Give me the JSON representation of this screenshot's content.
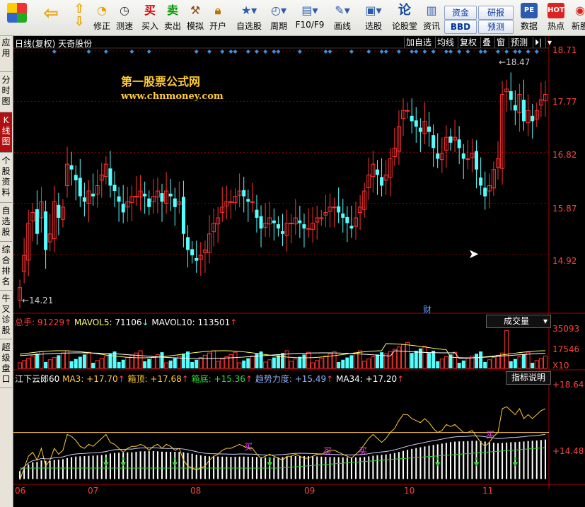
{
  "toolbar": {
    "buttons": [
      {
        "name": "fullscreen",
        "label": "",
        "icon": "grid-logo-icon"
      },
      {
        "name": "back",
        "label": "",
        "icon": "back-arrow-icon"
      },
      {
        "name": "up-down",
        "label": "",
        "icon": "up-down-icon"
      },
      {
        "name": "revise",
        "label": "修正",
        "icon": "revise-icon"
      },
      {
        "name": "measure",
        "label": "测速",
        "icon": "clock-icon"
      },
      {
        "name": "buy",
        "label": "买入",
        "icon": "buy-icon",
        "glyph": "买"
      },
      {
        "name": "sell",
        "label": "卖出",
        "icon": "sell-icon",
        "glyph": "卖"
      },
      {
        "name": "simulate",
        "label": "模拟",
        "icon": "hammer-icon"
      },
      {
        "name": "open-account",
        "label": "开户",
        "icon": "lock-icon"
      },
      {
        "name": "watchlist",
        "label": "自选股",
        "icon": "star-folder-icon"
      },
      {
        "name": "period",
        "label": "周期",
        "icon": "period-icon"
      },
      {
        "name": "f10",
        "label": "F10/F9",
        "icon": "f10-icon"
      },
      {
        "name": "draw",
        "label": "画线",
        "icon": "pencil-icon"
      },
      {
        "name": "select",
        "label": "选股",
        "icon": "select-icon"
      },
      {
        "name": "forum",
        "label": "论股堂",
        "icon": "forum-icon",
        "glyph": "论"
      },
      {
        "name": "news",
        "label": "资讯",
        "icon": "news-icon"
      },
      {
        "name": "data",
        "label": "数据",
        "icon": "pe-icon",
        "glyph": "PE"
      },
      {
        "name": "hot",
        "label": "热点",
        "icon": "hot-icon"
      },
      {
        "name": "new-stock",
        "label": "新股",
        "icon": "new-stock-icon"
      }
    ],
    "small": {
      "fund": "资金",
      "research": "研报",
      "bbd": "BBD",
      "predict": "预测"
    }
  },
  "sidebar": {
    "tabs": [
      {
        "label": "应用",
        "active": false
      },
      {
        "label": "分时图",
        "active": false
      },
      {
        "label": "K线图",
        "active": true
      },
      {
        "label": "个股资料",
        "active": false
      },
      {
        "label": "自选股",
        "active": false
      },
      {
        "label": "综合排名",
        "active": false
      },
      {
        "label": "牛叉诊股",
        "active": false
      },
      {
        "label": "超级盘口",
        "active": false
      }
    ]
  },
  "header": {
    "title": "日线(复权) 天奇股份",
    "buttons": [
      "加自选",
      "均线",
      "复权",
      "叠",
      "窗",
      "预测",
      "⏵|",
      "▾"
    ]
  },
  "watermark": {
    "line1": "第一股票公式网",
    "line2": "www.chnmoney.com"
  },
  "colors": {
    "up": "#ff3232",
    "down": "#54ffff",
    "grid": "#7a0000",
    "axis": "#b00000",
    "ma": "#ffffff",
    "diamond": "#3f8fd8"
  },
  "price": {
    "axis": [
      "18.71",
      "17.77",
      "16.82",
      "15.87",
      "14.92"
    ],
    "high_label": "18.47",
    "low_label": "14.21",
    "cai_label": "财",
    "range": [
      13.9,
      18.75
    ]
  },
  "volume": {
    "legend": {
      "total_label": "总手",
      "total_value": "91229",
      "mavol5_label": "MAVOL5",
      "mavol5_value": "71106",
      "mavol10_label": "MAVOL10",
      "mavol10_value": "113501"
    },
    "select": "成交量",
    "axis": [
      "35093",
      "17546",
      "X10"
    ]
  },
  "indicator": {
    "legend": {
      "name": "江下云郎60",
      "ma3_label": "MA3",
      "ma3_value": "+17.70",
      "top_label": "箱顶",
      "top_value": "+17.68",
      "bottom_label": "箱底",
      "bottom_value": "+15.36",
      "trend_label": "趋势力度",
      "trend_value": "+15.49",
      "ma34_label": "MA34",
      "ma34_value": "+17.20"
    },
    "button": "指标说明",
    "axis": [
      "+18.64",
      "+14.48"
    ],
    "buy_label": "买"
  },
  "xaxis": {
    "months": [
      "06",
      "07",
      "08",
      "09",
      "10",
      "11"
    ]
  },
  "chart_data": {
    "type": "candlestick",
    "title": "日线(复权) 天奇股份",
    "ylim": [
      13.9,
      18.75
    ],
    "close": [
      14.3,
      14.9,
      15.5,
      15.7,
      15.3,
      15.9,
      15.0,
      15.3,
      15.9,
      15.6,
      15.8,
      16.6,
      16.5,
      16.3,
      16.0,
      15.9,
      16.1,
      16.0,
      16.2,
      16.4,
      16.6,
      16.2,
      16.1,
      15.9,
      15.7,
      15.9,
      16.0,
      16.0,
      16.1,
      16.0,
      15.8,
      16.0,
      16.1,
      15.9,
      16.1,
      16.0,
      15.8,
      15.9,
      15.3,
      15.0,
      14.9,
      14.8,
      14.9,
      15.0,
      15.3,
      15.5,
      15.6,
      15.8,
      15.9,
      15.9,
      16.0,
      16.1,
      16.0,
      15.9,
      15.9,
      15.6,
      15.4,
      15.5,
      15.6,
      15.5,
      15.4,
      15.3,
      15.5,
      15.5,
      15.6,
      15.5,
      15.4,
      15.4,
      15.5,
      15.6,
      15.6,
      15.7,
      15.8,
      15.8,
      15.7,
      15.6,
      15.5,
      15.4,
      15.6,
      15.8,
      16.1,
      16.4,
      16.6,
      16.4,
      16.2,
      16.4,
      16.7,
      16.9,
      17.3,
      17.6,
      17.6,
      17.4,
      17.3,
      17.2,
      17.4,
      17.2,
      16.9,
      16.7,
      16.8,
      17.1,
      17.0,
      17.1,
      16.9,
      16.7,
      16.7,
      16.8,
      16.5,
      16.2,
      16.0,
      16.2,
      16.5,
      16.7,
      17.9,
      18.0,
      17.8,
      17.6,
      17.9,
      17.4,
      17.6,
      17.4,
      17.6,
      17.8,
      17.9
    ]
  }
}
